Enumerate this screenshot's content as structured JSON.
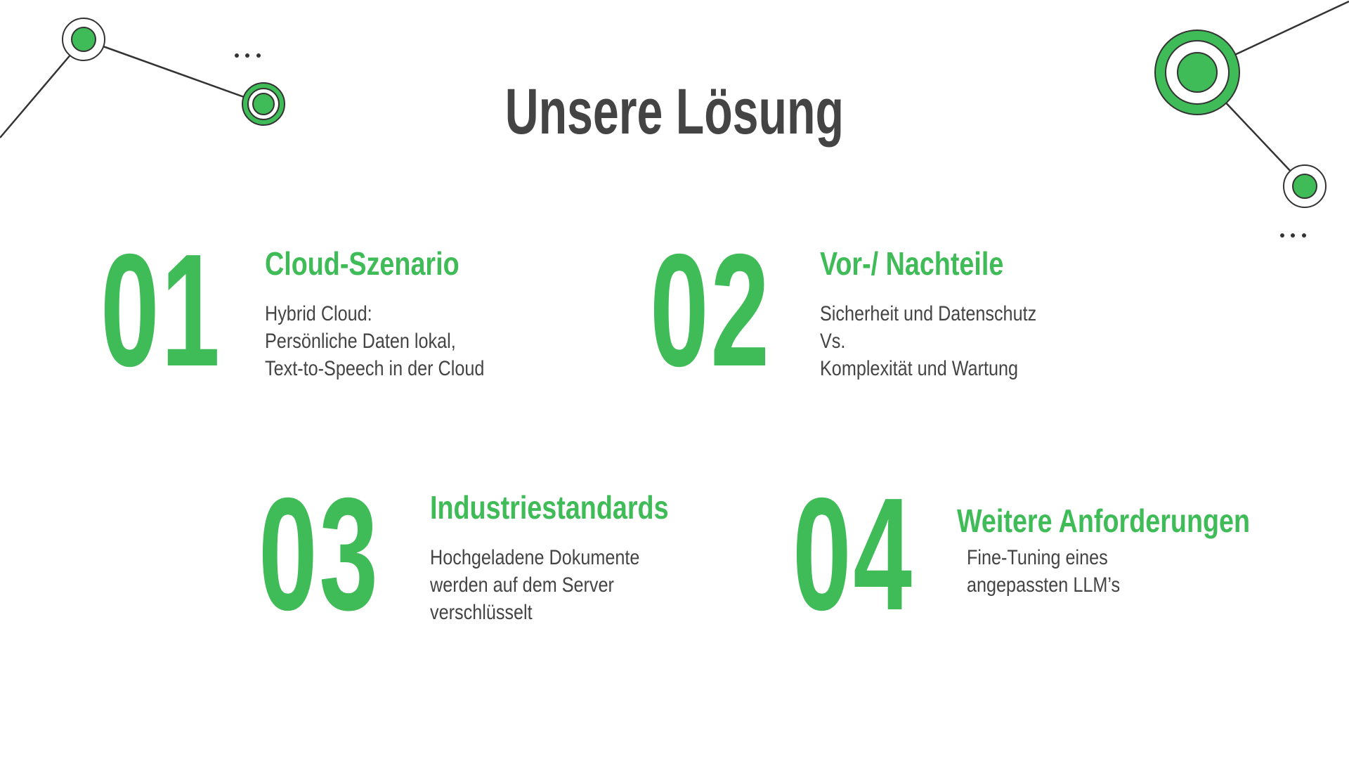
{
  "title": "Unsere Lösung",
  "colors": {
    "accent": "#3fbb57",
    "text": "#444444",
    "line": "#333333"
  },
  "items": [
    {
      "number": "01",
      "heading": "Cloud-Szenario",
      "lines": [
        "Hybrid Cloud:",
        "Persönliche Daten lokal,",
        "Text-to-Speech in der Cloud"
      ]
    },
    {
      "number": "02",
      "heading": "Vor-/ Nachteile",
      "lines": [
        "Sicherheit und Datenschutz",
        "Vs.",
        "Komplexität und Wartung"
      ]
    },
    {
      "number": "03",
      "heading": "Industriestandards",
      "lines": [
        "Hochgeladene Dokumente",
        "werden auf dem Server",
        "verschlüsselt"
      ]
    },
    {
      "number": "04",
      "heading": "Weitere Anforderungen",
      "lines": [
        "Fine-Tuning eines",
        "angepassten LLM’s"
      ]
    }
  ]
}
